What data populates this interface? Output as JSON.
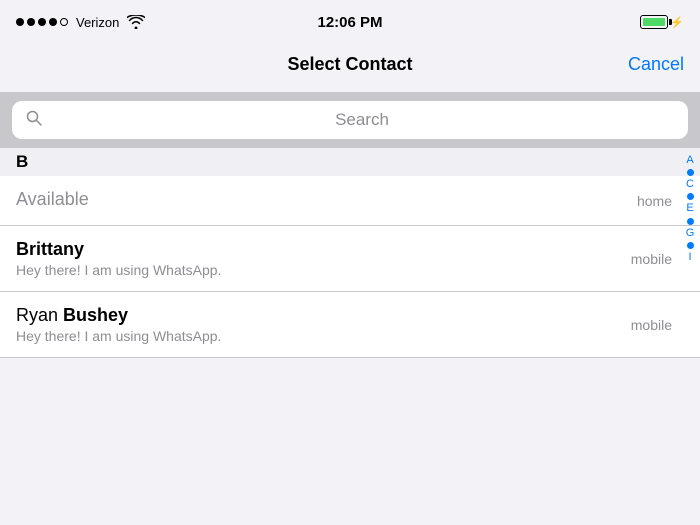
{
  "statusBar": {
    "carrier": "Verizon",
    "time": "12:06 PM",
    "signalDots": 4,
    "signalEmpty": 1
  },
  "navBar": {
    "title": "Select Contact",
    "cancelLabel": "Cancel"
  },
  "search": {
    "placeholder": "Search"
  },
  "sectionHeaders": {
    "b": "B"
  },
  "contacts": [
    {
      "id": "available",
      "nameFirst": "Available",
      "nameLast": "",
      "nameBold": false,
      "status": "",
      "phoneType": "home",
      "partial": true
    },
    {
      "id": "brittany",
      "nameFirst": "Brittany",
      "nameLast": "",
      "nameBold": true,
      "status": "Hey there! I am using WhatsApp.",
      "phoneType": "mobile",
      "partial": false
    },
    {
      "id": "ryan-bushey",
      "nameFirst": "Ryan",
      "nameLast": "Bushey",
      "nameBold": false,
      "nameLastBold": true,
      "status": "Hey there! I am using WhatsApp.",
      "phoneType": "mobile",
      "partial": false
    }
  ],
  "indexSidebar": {
    "items": [
      "A",
      "C",
      "E",
      "G",
      "I"
    ]
  },
  "colors": {
    "accent": "#007aff",
    "batteryGreen": "#4cd964"
  }
}
